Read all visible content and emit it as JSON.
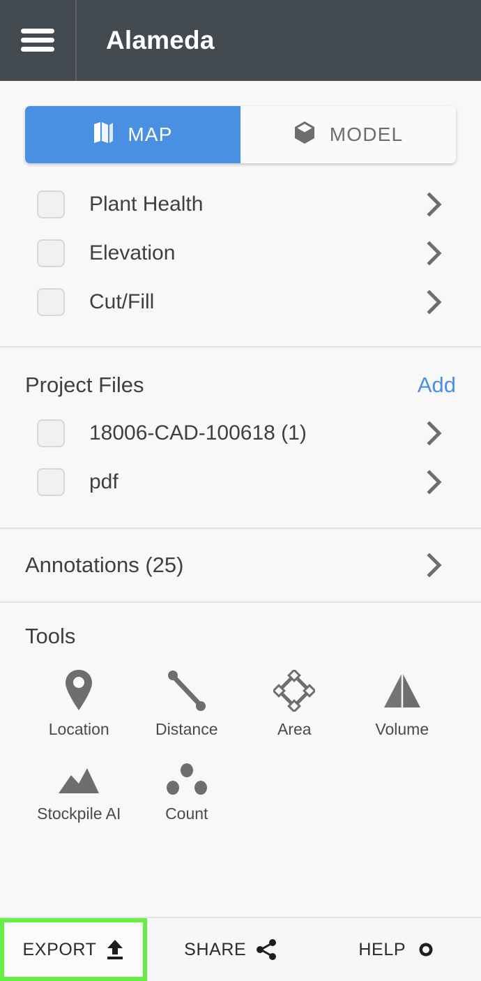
{
  "header": {
    "menu_icon": "hamburger-icon",
    "title": "Alameda"
  },
  "view_toggle": {
    "map": {
      "label": "MAP",
      "icon": "map-icon",
      "active": true
    },
    "model": {
      "label": "MODEL",
      "icon": "cube-icon",
      "active": false
    }
  },
  "layers": [
    {
      "label": "Plant Health",
      "checked": false
    },
    {
      "label": "Elevation",
      "checked": false
    },
    {
      "label": "Cut/Fill",
      "checked": false
    }
  ],
  "project_files": {
    "title": "Project Files",
    "add_label": "Add",
    "items": [
      {
        "label": "18006-CAD-100618 (1)",
        "checked": false
      },
      {
        "label": "pdf",
        "checked": false
      }
    ]
  },
  "annotations": {
    "label": "Annotations (25)",
    "count": 25
  },
  "tools": {
    "title": "Tools",
    "items": [
      {
        "label": "Location",
        "icon": "map-pin-icon"
      },
      {
        "label": "Distance",
        "icon": "ruler-line-icon"
      },
      {
        "label": "Area",
        "icon": "polygon-diamond-icon"
      },
      {
        "label": "Volume",
        "icon": "pyramid-icon"
      },
      {
        "label": "Stockpile AI",
        "icon": "mountain-icon"
      },
      {
        "label": "Count",
        "icon": "three-dots-icon"
      }
    ]
  },
  "bottom_bar": {
    "export": {
      "label": "EXPORT",
      "icon": "upload-icon",
      "highlighted": true
    },
    "share": {
      "label": "SHARE",
      "icon": "share-nodes-icon"
    },
    "help": {
      "label": "HELP",
      "icon": "lifebuoy-icon"
    }
  },
  "colors": {
    "header_bg": "#444b50",
    "accent_blue": "#4a90e2",
    "highlight_green": "#66ee44",
    "page_bg": "#f8f8f8",
    "icon_gray": "#6e6e6e"
  }
}
